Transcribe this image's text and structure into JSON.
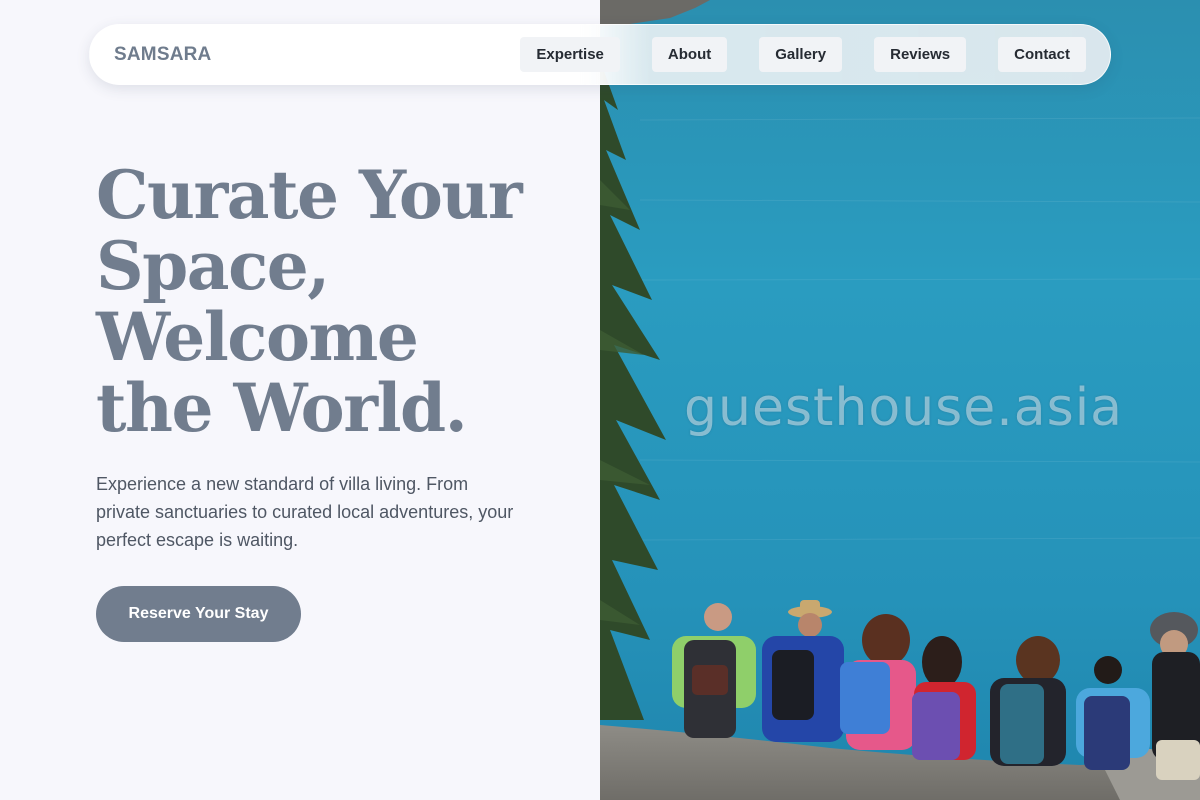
{
  "brand": {
    "name": "SAMSARA"
  },
  "nav": {
    "links": [
      {
        "label": "Expertise"
      },
      {
        "label": "About"
      },
      {
        "label": "Gallery"
      },
      {
        "label": "Reviews"
      },
      {
        "label": "Contact"
      }
    ]
  },
  "hero": {
    "headline_lines": [
      "Curate Your",
      "Space,",
      "Welcome",
      "the World."
    ],
    "subtext": "Experience a new standard of villa living. From private sanctuaries to curated local adventures, your perfect escape is waiting.",
    "cta_label": "Reserve Your Stay",
    "watermark": "guesthouse.asia"
  },
  "colors": {
    "page_background": "#f7f7fc",
    "accent_slate": "#717d8e",
    "lake_blue": "#2a9cc0",
    "nav_text": "#262b33"
  }
}
